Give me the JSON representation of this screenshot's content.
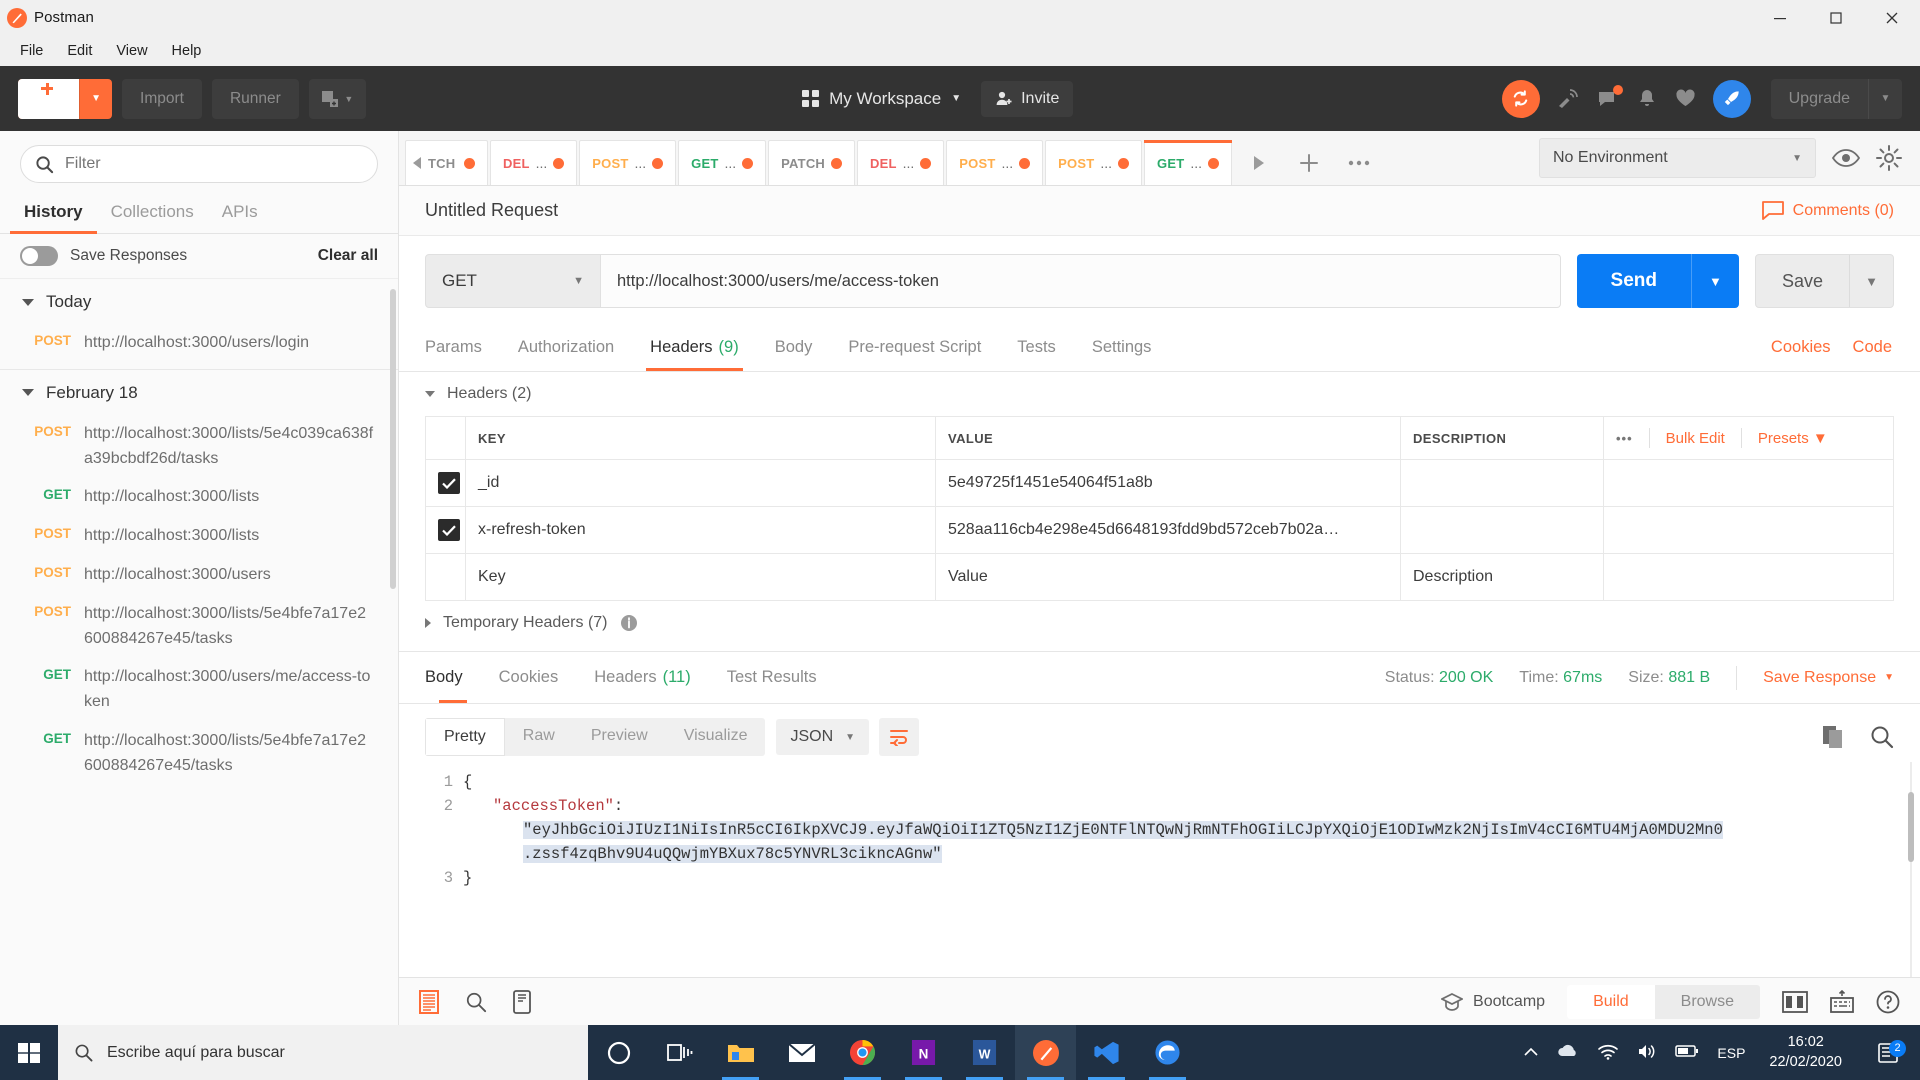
{
  "window": {
    "title": "Postman",
    "minimize": "−",
    "maximize": "▢",
    "close": "✕"
  },
  "menu": [
    "File",
    "Edit",
    "View",
    "Help"
  ],
  "toolbar": {
    "new_label": "New",
    "import_label": "Import",
    "runner_label": "Runner",
    "workspace_label": "My Workspace",
    "invite_label": "Invite",
    "upgrade_label": "Upgrade",
    "icons": [
      "sync-icon",
      "satellite-icon",
      "comment-icon",
      "bell-icon",
      "heart-icon",
      "rocket-icon"
    ]
  },
  "sidebar": {
    "filter_placeholder": "Filter",
    "tabs": [
      {
        "label": "History",
        "active": true
      },
      {
        "label": "Collections",
        "active": false
      },
      {
        "label": "APIs",
        "active": false
      }
    ],
    "save_responses_label": "Save Responses",
    "clear_all_label": "Clear all",
    "groups": [
      {
        "title": "Today",
        "items": [
          {
            "method": "POST",
            "url": "http://localhost:3000/users/login"
          }
        ]
      },
      {
        "title": "February 18",
        "items": [
          {
            "method": "POST",
            "url": "http://localhost:3000/lists/5e4c039ca638fa39bcbdf26d/tasks"
          },
          {
            "method": "GET",
            "url": "http://localhost:3000/lists"
          },
          {
            "method": "POST",
            "url": "http://localhost:3000/lists"
          },
          {
            "method": "POST",
            "url": "http://localhost:3000/users"
          },
          {
            "method": "POST",
            "url": "http://localhost:3000/lists/5e4bfe7a17e2600884267e45/tasks"
          },
          {
            "method": "GET",
            "url": "http://localhost:3000/users/me/access-token"
          },
          {
            "method": "GET",
            "url": "http://localhost:3000/lists/5e4bfe7a17e2600884267e45/tasks"
          }
        ]
      }
    ]
  },
  "request_tabs": [
    {
      "method": "TCH",
      "name": "",
      "active": false
    },
    {
      "method": "DEL",
      "name": "...",
      "active": false
    },
    {
      "method": "POST",
      "name": "...",
      "active": false
    },
    {
      "method": "GET",
      "name": "...",
      "active": false
    },
    {
      "method": "PATCH",
      "name": "",
      "active": false
    },
    {
      "method": "DEL",
      "name": "...",
      "active": false
    },
    {
      "method": "POST",
      "name": "...",
      "active": false
    },
    {
      "method": "POST",
      "name": "...",
      "active": false
    },
    {
      "method": "GET",
      "name": "...",
      "active": true
    }
  ],
  "environment": {
    "selected": "No Environment"
  },
  "request": {
    "title": "Untitled Request",
    "comments_label": "Comments (0)",
    "method": "GET",
    "url": "http://localhost:3000/users/me/access-token",
    "send_label": "Send",
    "save_label": "Save",
    "tabs": [
      {
        "label": "Params",
        "count": "",
        "active": false
      },
      {
        "label": "Authorization",
        "count": "",
        "active": false
      },
      {
        "label": "Headers",
        "count": "(9)",
        "active": true
      },
      {
        "label": "Body",
        "count": "",
        "active": false
      },
      {
        "label": "Pre-request Script",
        "count": "",
        "active": false
      },
      {
        "label": "Tests",
        "count": "",
        "active": false
      },
      {
        "label": "Settings",
        "count": "",
        "active": false
      }
    ],
    "cookies_label": "Cookies",
    "code_label": "Code"
  },
  "headers_section": {
    "collapse_label": "Headers (2)",
    "columns": [
      "KEY",
      "VALUE",
      "DESCRIPTION"
    ],
    "bulk_edit_label": "Bulk Edit",
    "presets_label": "Presets",
    "rows": [
      {
        "checked": true,
        "key": "_id",
        "value": "5e49725f1451e54064f51a8b",
        "description": ""
      },
      {
        "checked": true,
        "key": "x-refresh-token",
        "value": "528aa116cb4e298e45d6648193fdd9bd572ceb7b02a…",
        "description": ""
      }
    ],
    "placeholder_row": {
      "key": "Key",
      "value": "Value",
      "description": "Description"
    },
    "temporary_headers_label": "Temporary Headers (7)"
  },
  "response": {
    "tabs": [
      {
        "label": "Body",
        "count": "",
        "active": true
      },
      {
        "label": "Cookies",
        "count": "",
        "active": false
      },
      {
        "label": "Headers",
        "count": "(11)",
        "active": false
      },
      {
        "label": "Test Results",
        "count": "",
        "active": false
      }
    ],
    "status_label": "Status:",
    "status_value": "200 OK",
    "time_label": "Time:",
    "time_value": "67ms",
    "size_label": "Size:",
    "size_value": "881 B",
    "save_response_label": "Save Response",
    "view_modes": [
      {
        "label": "Pretty",
        "active": true
      },
      {
        "label": "Raw",
        "active": false
      },
      {
        "label": "Preview",
        "active": false
      },
      {
        "label": "Visualize",
        "active": false
      }
    ],
    "format": "JSON",
    "line_numbers": [
      "1",
      "2",
      "3"
    ],
    "body_line1": "{",
    "body_key": "\"accessToken\"",
    "body_colon": ":",
    "body_value_part1": "\"eyJhbGciOiJIUzI1NiIsInR5cCI6IkpXVCJ9.eyJfaWQiOiI1ZTQ5NzI1ZjE0NTFlNTQwNjRmNTFhOGIiLCJpYXQiOjE1ODIwMzk2NjIsImV4cCI6MTU4MjA0MDU2Mn0",
    "body_value_part2": ".zssf4zqBhv9U4uQQwjmYBXux78c5YNVRL3cikncAGnw\"",
    "body_line3": "}"
  },
  "footer": {
    "bootcamp_label": "Bootcamp",
    "build_label": "Build",
    "browse_label": "Browse"
  },
  "taskbar": {
    "search_placeholder": "Escribe aquí para buscar",
    "language": "ESP",
    "time": "16:02",
    "date": "22/02/2020",
    "notification_count": "2"
  },
  "colors": {
    "accent": "#ff6c37",
    "send_blue": "#0a7cf5",
    "get_green": "#2cab6a",
    "post_amber": "#ffae4c",
    "delete_red": "#ef6160",
    "dark_toolbar": "#333333"
  }
}
